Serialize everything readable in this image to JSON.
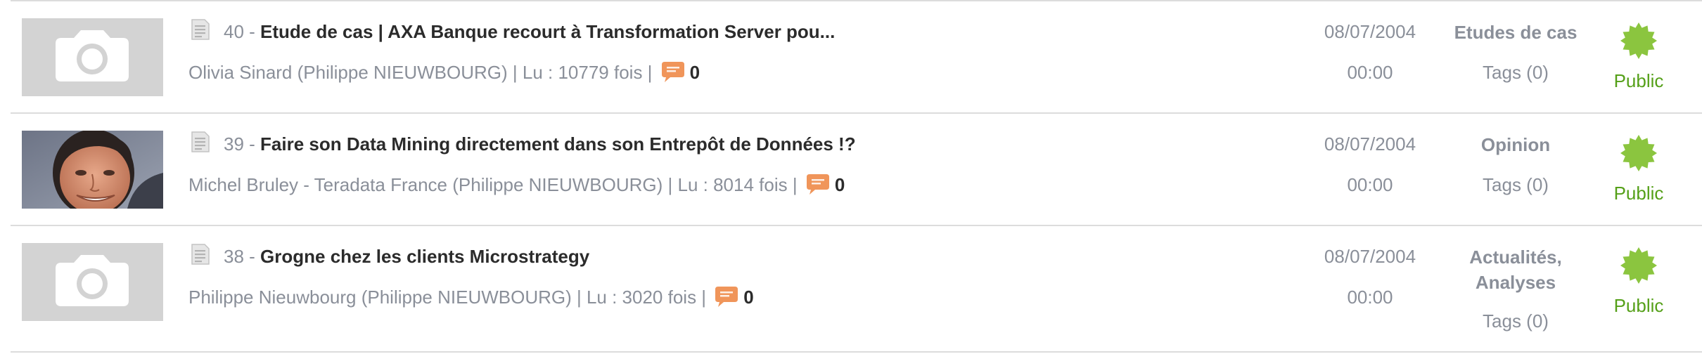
{
  "articles": [
    {
      "number": "40",
      "separator": " - ",
      "title": "Etude de cas | AXA Banque recourt à Transformation Server pou...",
      "meta": "Olivia Sinard (Philippe NIEUWBOURG) | Lu : 10779 fois |",
      "comments": "0",
      "date": "08/07/2004",
      "time": "00:00",
      "category": "Etudes de cas",
      "tags": "Tags (0)",
      "status": "Public",
      "thumbnail": "camera-placeholder"
    },
    {
      "number": "39",
      "separator": " - ",
      "title": "Faire son Data Mining directement dans son Entrepôt de Données !?",
      "meta": "Michel Bruley - Teradata France (Philippe NIEUWBOURG) | Lu : 8014 fois |",
      "comments": "0",
      "date": "08/07/2004",
      "time": "00:00",
      "category": "Opinion",
      "tags": "Tags (0)",
      "status": "Public",
      "thumbnail": "author-photo"
    },
    {
      "number": "38",
      "separator": " - ",
      "title": "Grogne chez les clients Microstrategy",
      "meta": "Philippe Nieuwbourg (Philippe NIEUWBOURG) | Lu : 3020 fois |",
      "comments": "0",
      "date": "08/07/2004",
      "time": "00:00",
      "category_lines": [
        "Actualités,",
        "Analyses"
      ],
      "tags": "Tags (0)",
      "status": "Public",
      "thumbnail": "camera-placeholder"
    }
  ],
  "colors": {
    "status_green": "#55a019",
    "badge_green": "#8bc53f",
    "comment_orange": "#f0955a",
    "muted_text": "#8a8f99",
    "title_text": "#2b2b2b",
    "divider": "#dcdcdc"
  },
  "icons": {
    "article_type": "document-icon",
    "comments": "comment-bubble-icon",
    "status": "published-badge-icon",
    "thumbnail_placeholder": "camera-icon"
  }
}
